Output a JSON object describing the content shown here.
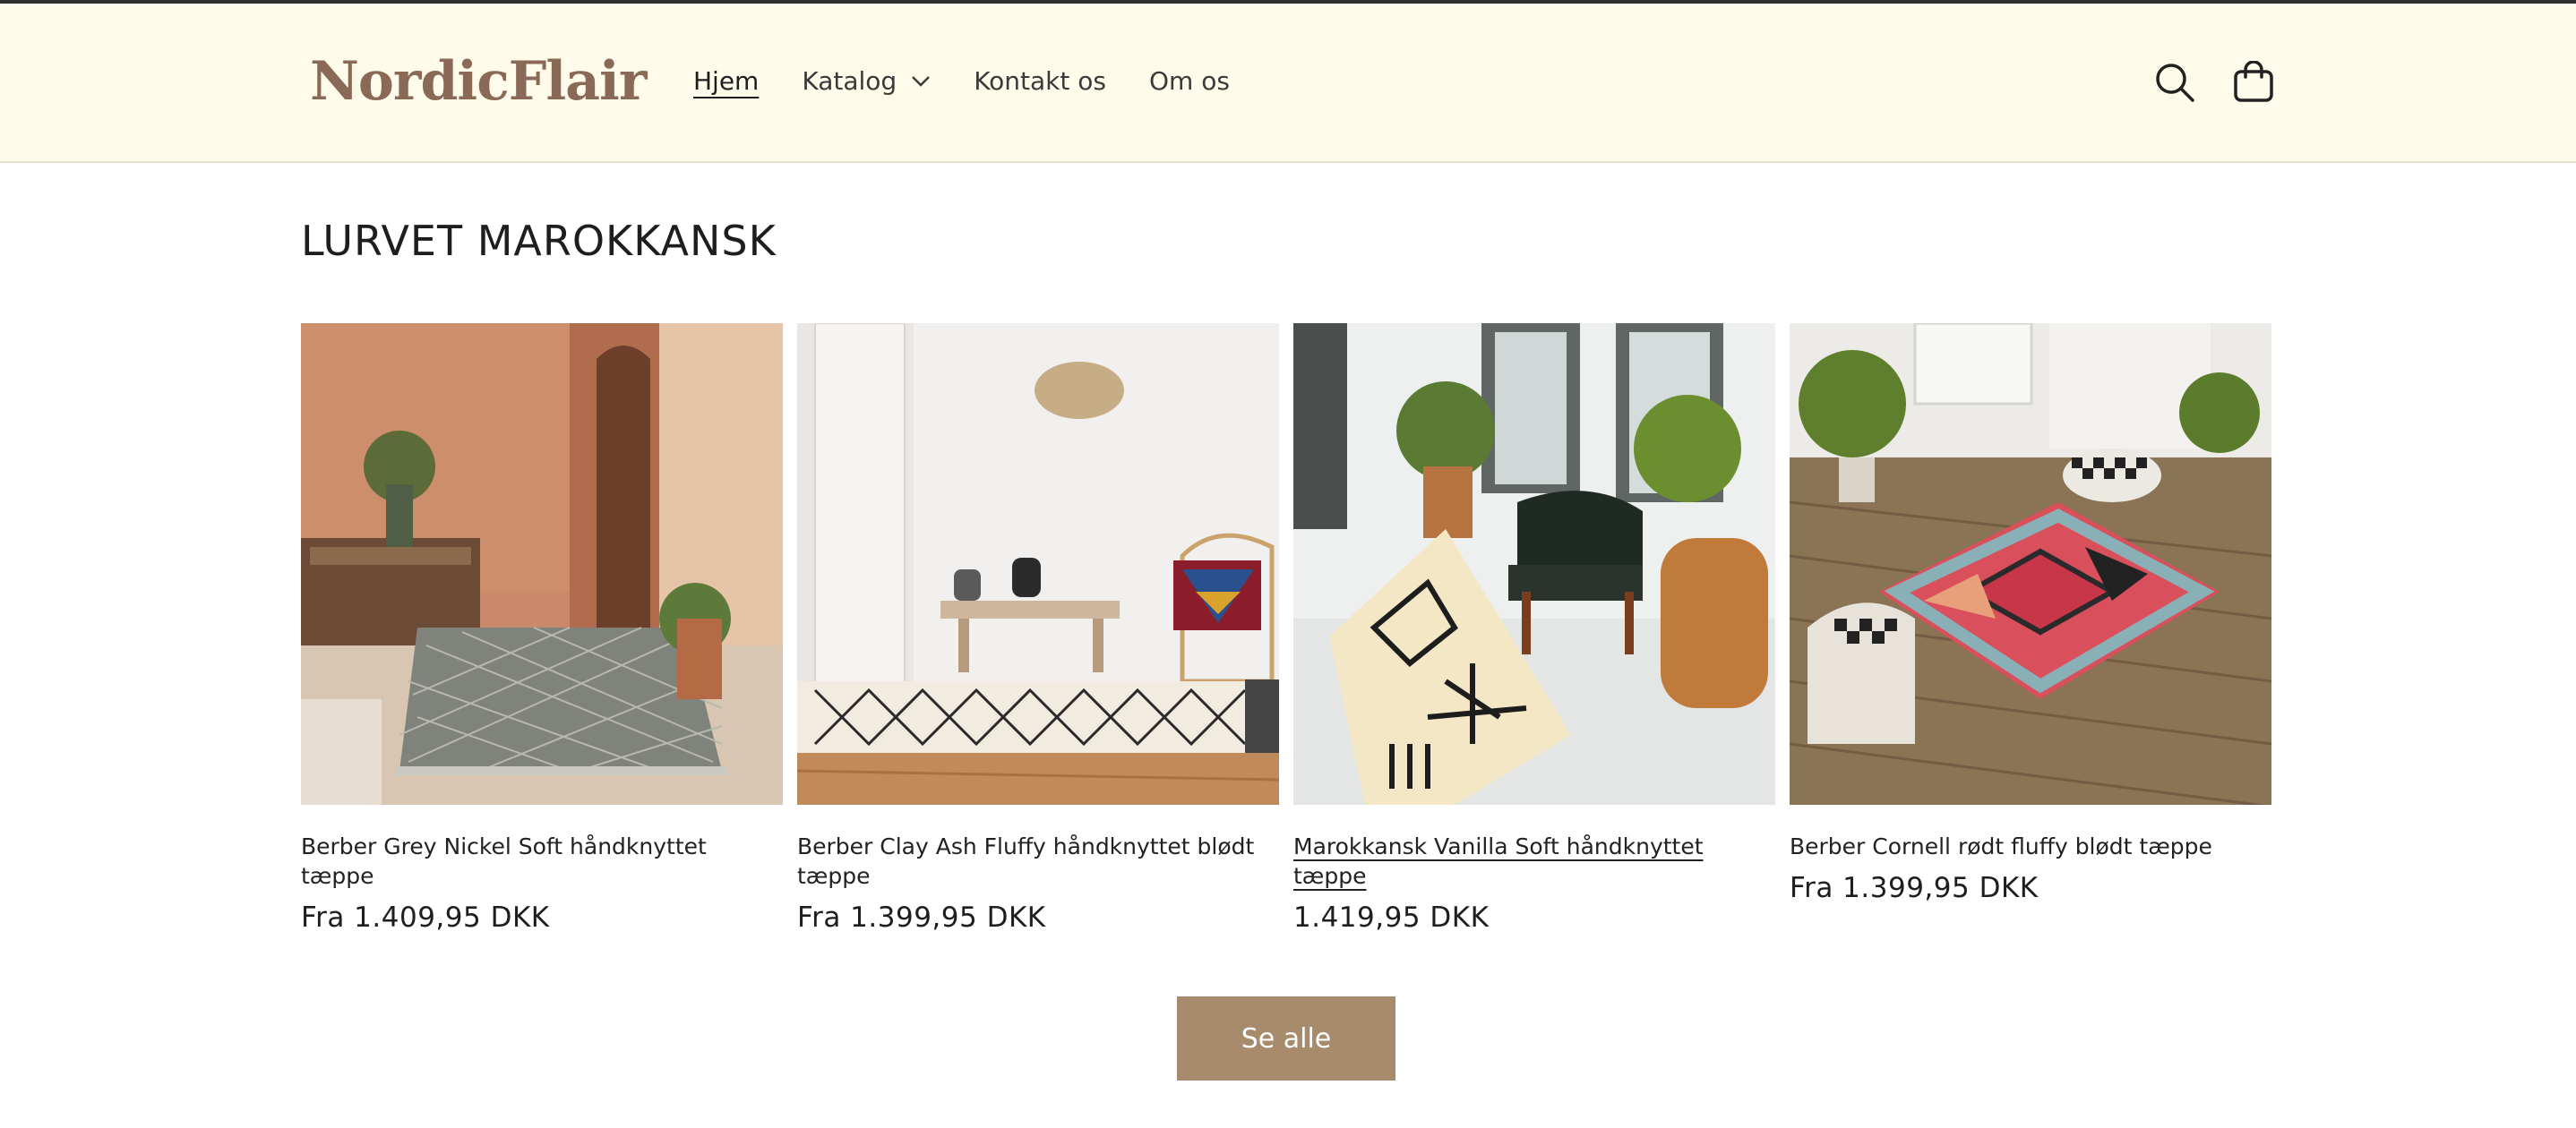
{
  "header": {
    "logo": "NordicFlair",
    "nav": [
      {
        "label": "Hjem",
        "active": true
      },
      {
        "label": "Katalog",
        "has_dropdown": true
      },
      {
        "label": "Kontakt os"
      },
      {
        "label": "Om os"
      }
    ],
    "icons": [
      "search-icon",
      "cart-icon"
    ]
  },
  "section": {
    "title": "LURVET MAROKKANSK",
    "products": [
      {
        "title": "Berber Grey Nickel Soft håndknyttet tæppe",
        "price": "Fra 1.409,95 DKK"
      },
      {
        "title": "Berber Clay Ash Fluffy håndknyttet blødt tæppe",
        "price": "Fra 1.399,95 DKK"
      },
      {
        "title": "Marokkansk Vanilla Soft håndknyttet tæppe",
        "price": "1.419,95 DKK"
      },
      {
        "title": "Berber Cornell rødt fluffy blødt tæppe",
        "price": "Fra 1.399,95 DKK"
      }
    ],
    "see_all_label": "Se alle"
  },
  "colors": {
    "header_bg": "#fffbea",
    "logo": "#8a6a57",
    "button_bg": "#a88a6d"
  }
}
